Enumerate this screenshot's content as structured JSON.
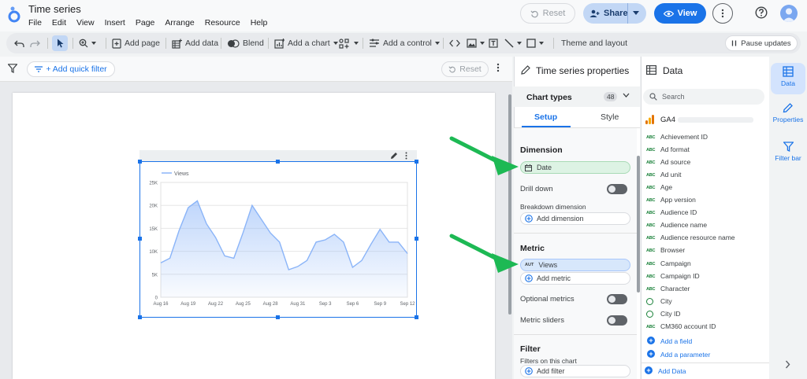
{
  "app": {
    "title": "Time series",
    "menu": [
      "File",
      "Edit",
      "View",
      "Insert",
      "Page",
      "Arrange",
      "Resource",
      "Help"
    ],
    "reset_label": "Reset",
    "share_label": "Share",
    "view_label": "View"
  },
  "toolbar": {
    "add_page": "Add page",
    "add_data": "Add data",
    "blend": "Blend",
    "add_chart": "Add a chart",
    "add_control": "Add a control",
    "theme_layout": "Theme and layout",
    "pause_updates": "Pause updates"
  },
  "filter_bar": {
    "add_quick_filter": "+ Add quick filter",
    "reset_label": "Reset"
  },
  "chart": {
    "legend": "Views",
    "y_ticks": [
      "25K",
      "20K",
      "15K",
      "10K",
      "5K",
      "0"
    ],
    "x_ticks": [
      "Aug 16",
      "Aug 19",
      "Aug 22",
      "Aug 25",
      "Aug 28",
      "Aug 31",
      "Sep 3",
      "Sep 6",
      "Sep 9",
      "Sep 12"
    ]
  },
  "chart_data": {
    "type": "area",
    "title": "",
    "xlabel": "",
    "ylabel": "",
    "ylim": [
      0,
      25000
    ],
    "x": [
      "Aug 16",
      "Aug 17",
      "Aug 18",
      "Aug 19",
      "Aug 20",
      "Aug 21",
      "Aug 22",
      "Aug 23",
      "Aug 24",
      "Aug 25",
      "Aug 26",
      "Aug 27",
      "Aug 28",
      "Aug 29",
      "Aug 30",
      "Aug 31",
      "Sep 1",
      "Sep 2",
      "Sep 3",
      "Sep 4",
      "Sep 5",
      "Sep 6",
      "Sep 7",
      "Sep 8",
      "Sep 9",
      "Sep 10",
      "Sep 11",
      "Sep 12"
    ],
    "series": [
      {
        "name": "Views",
        "values": [
          7500,
          8500,
          14500,
          19500,
          21000,
          16000,
          13000,
          9000,
          8500,
          14000,
          20000,
          17000,
          14000,
          12000,
          6000,
          6700,
          8000,
          12000,
          12500,
          13700,
          12000,
          6500,
          8000,
          11500,
          14800,
          12000,
          12000,
          9500
        ]
      }
    ],
    "grid": true,
    "legend_position": "top-left"
  },
  "properties": {
    "title": "Time series properties",
    "chart_types_label": "Chart types",
    "chart_types_count": "48",
    "tabs": [
      "Setup",
      "Style"
    ],
    "dimension_title": "Dimension",
    "dimension_field": "Date",
    "drill_down": "Drill down",
    "breakdown_dimension": "Breakdown dimension",
    "add_dimension": "Add dimension",
    "metric_title": "Metric",
    "metric_badge": "AUT",
    "metric_field": "Views",
    "add_metric": "Add metric",
    "optional_metrics": "Optional metrics",
    "metric_sliders": "Metric sliders",
    "filter_title": "Filter",
    "filters_on_chart": "Filters on this chart",
    "add_filter": "Add filter"
  },
  "data_panel": {
    "title": "Data",
    "search_placeholder": "Search",
    "source": "GA4",
    "fields": [
      "Achievement ID",
      "Ad format",
      "Ad source",
      "Ad unit",
      "Age",
      "App version",
      "Audience ID",
      "Audience name",
      "Audience resource name",
      "Browser",
      "Campaign",
      "Campaign ID",
      "Character",
      "City",
      "City ID",
      "CM360 account ID"
    ],
    "field_icons": [
      "abc",
      "abc",
      "abc",
      "abc",
      "abc",
      "abc",
      "abc",
      "abc",
      "abc",
      "abc",
      "abc",
      "abc",
      "abc",
      "globe",
      "globe",
      "abc"
    ],
    "abc_label": "ABC",
    "add_field": "Add a field",
    "add_parameter": "Add a parameter",
    "add_data": "Add Data"
  },
  "rail": {
    "data": "Data",
    "properties": "Properties",
    "filter_bar": "Filter bar"
  },
  "colors": {
    "accent": "#1a73e8",
    "line": "#8ab4f8",
    "arrow": "#1db954"
  }
}
